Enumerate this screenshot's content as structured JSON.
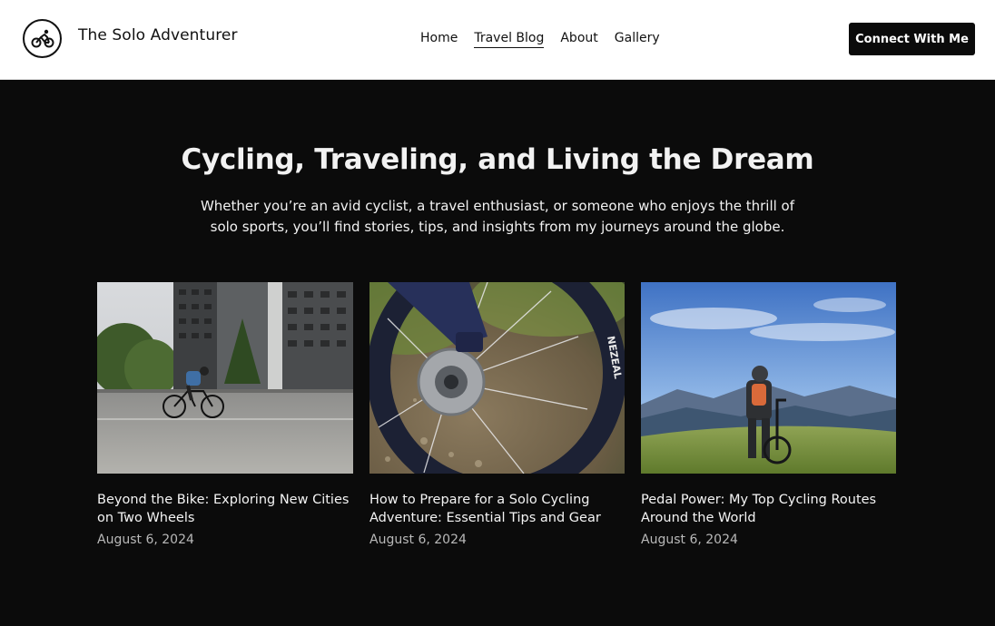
{
  "header": {
    "site_title": "The Solo Adventurer",
    "logo_icon": "cyclist-icon",
    "nav": [
      {
        "label": "Home"
      },
      {
        "label": "Travel Blog",
        "active": true
      },
      {
        "label": "About"
      },
      {
        "label": "Gallery"
      }
    ],
    "cta_label": "Connect With Me"
  },
  "hero": {
    "title": "Cycling, Traveling, and Living the Dream",
    "subtitle": "Whether you’re an avid cyclist, a travel enthusiast, or someone who enjoys the thrill of solo sports, you’ll find stories, tips, and insights from my journeys around the globe."
  },
  "posts": [
    {
      "title": "Beyond the Bike: Exploring New Cities on Two Wheels",
      "date": "August 6, 2024",
      "image": "cyclist riding past modern buildings"
    },
    {
      "title": "How to Prepare for a Solo Cycling Adventure: Essential Tips and Gear",
      "date": "August 6, 2024",
      "image": "close-up of bicycle disc brake and wheel"
    },
    {
      "title": "Pedal Power: My Top Cycling Routes Around the World",
      "date": "August 6, 2024",
      "image": "cyclist overlooking mountain valley"
    }
  ],
  "colors": {
    "background": "#0b0b0b",
    "header_bg": "#ffffff",
    "text_light": "#f2f2f2",
    "date_gray": "#b9b9b9"
  }
}
